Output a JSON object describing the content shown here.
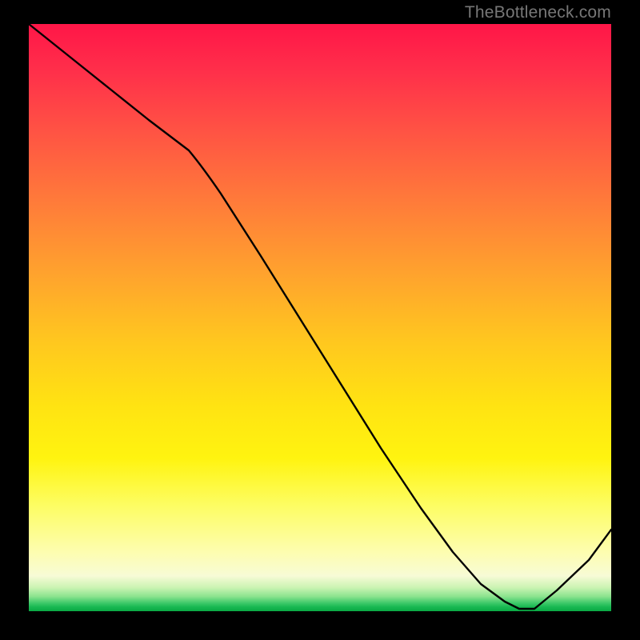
{
  "watermark": "TheBottleneck.com",
  "region_label": "",
  "chart_data": {
    "type": "line",
    "title": "",
    "xlabel": "",
    "ylabel": "",
    "xlim": [
      0,
      100
    ],
    "ylim": [
      0,
      100
    ],
    "series": [
      {
        "name": "curve",
        "x": [
          0,
          5,
          10,
          15,
          20,
          25,
          30,
          35,
          40,
          45,
          50,
          55,
          60,
          65,
          70,
          75,
          80,
          83,
          86,
          90,
          95,
          100
        ],
        "y": [
          100,
          95,
          90,
          85,
          80,
          75,
          68,
          60,
          52,
          44,
          36,
          28,
          20,
          13,
          7,
          3,
          1,
          0,
          0,
          3,
          8,
          14
        ]
      }
    ],
    "optimal_region_x": [
      74,
      88
    ],
    "gradient_stops": [
      {
        "pos": 0,
        "color": "#ff1648"
      },
      {
        "pos": 50,
        "color": "#ffc71f"
      },
      {
        "pos": 80,
        "color": "#fdfd63"
      },
      {
        "pos": 100,
        "color": "#0aa944"
      }
    ]
  }
}
